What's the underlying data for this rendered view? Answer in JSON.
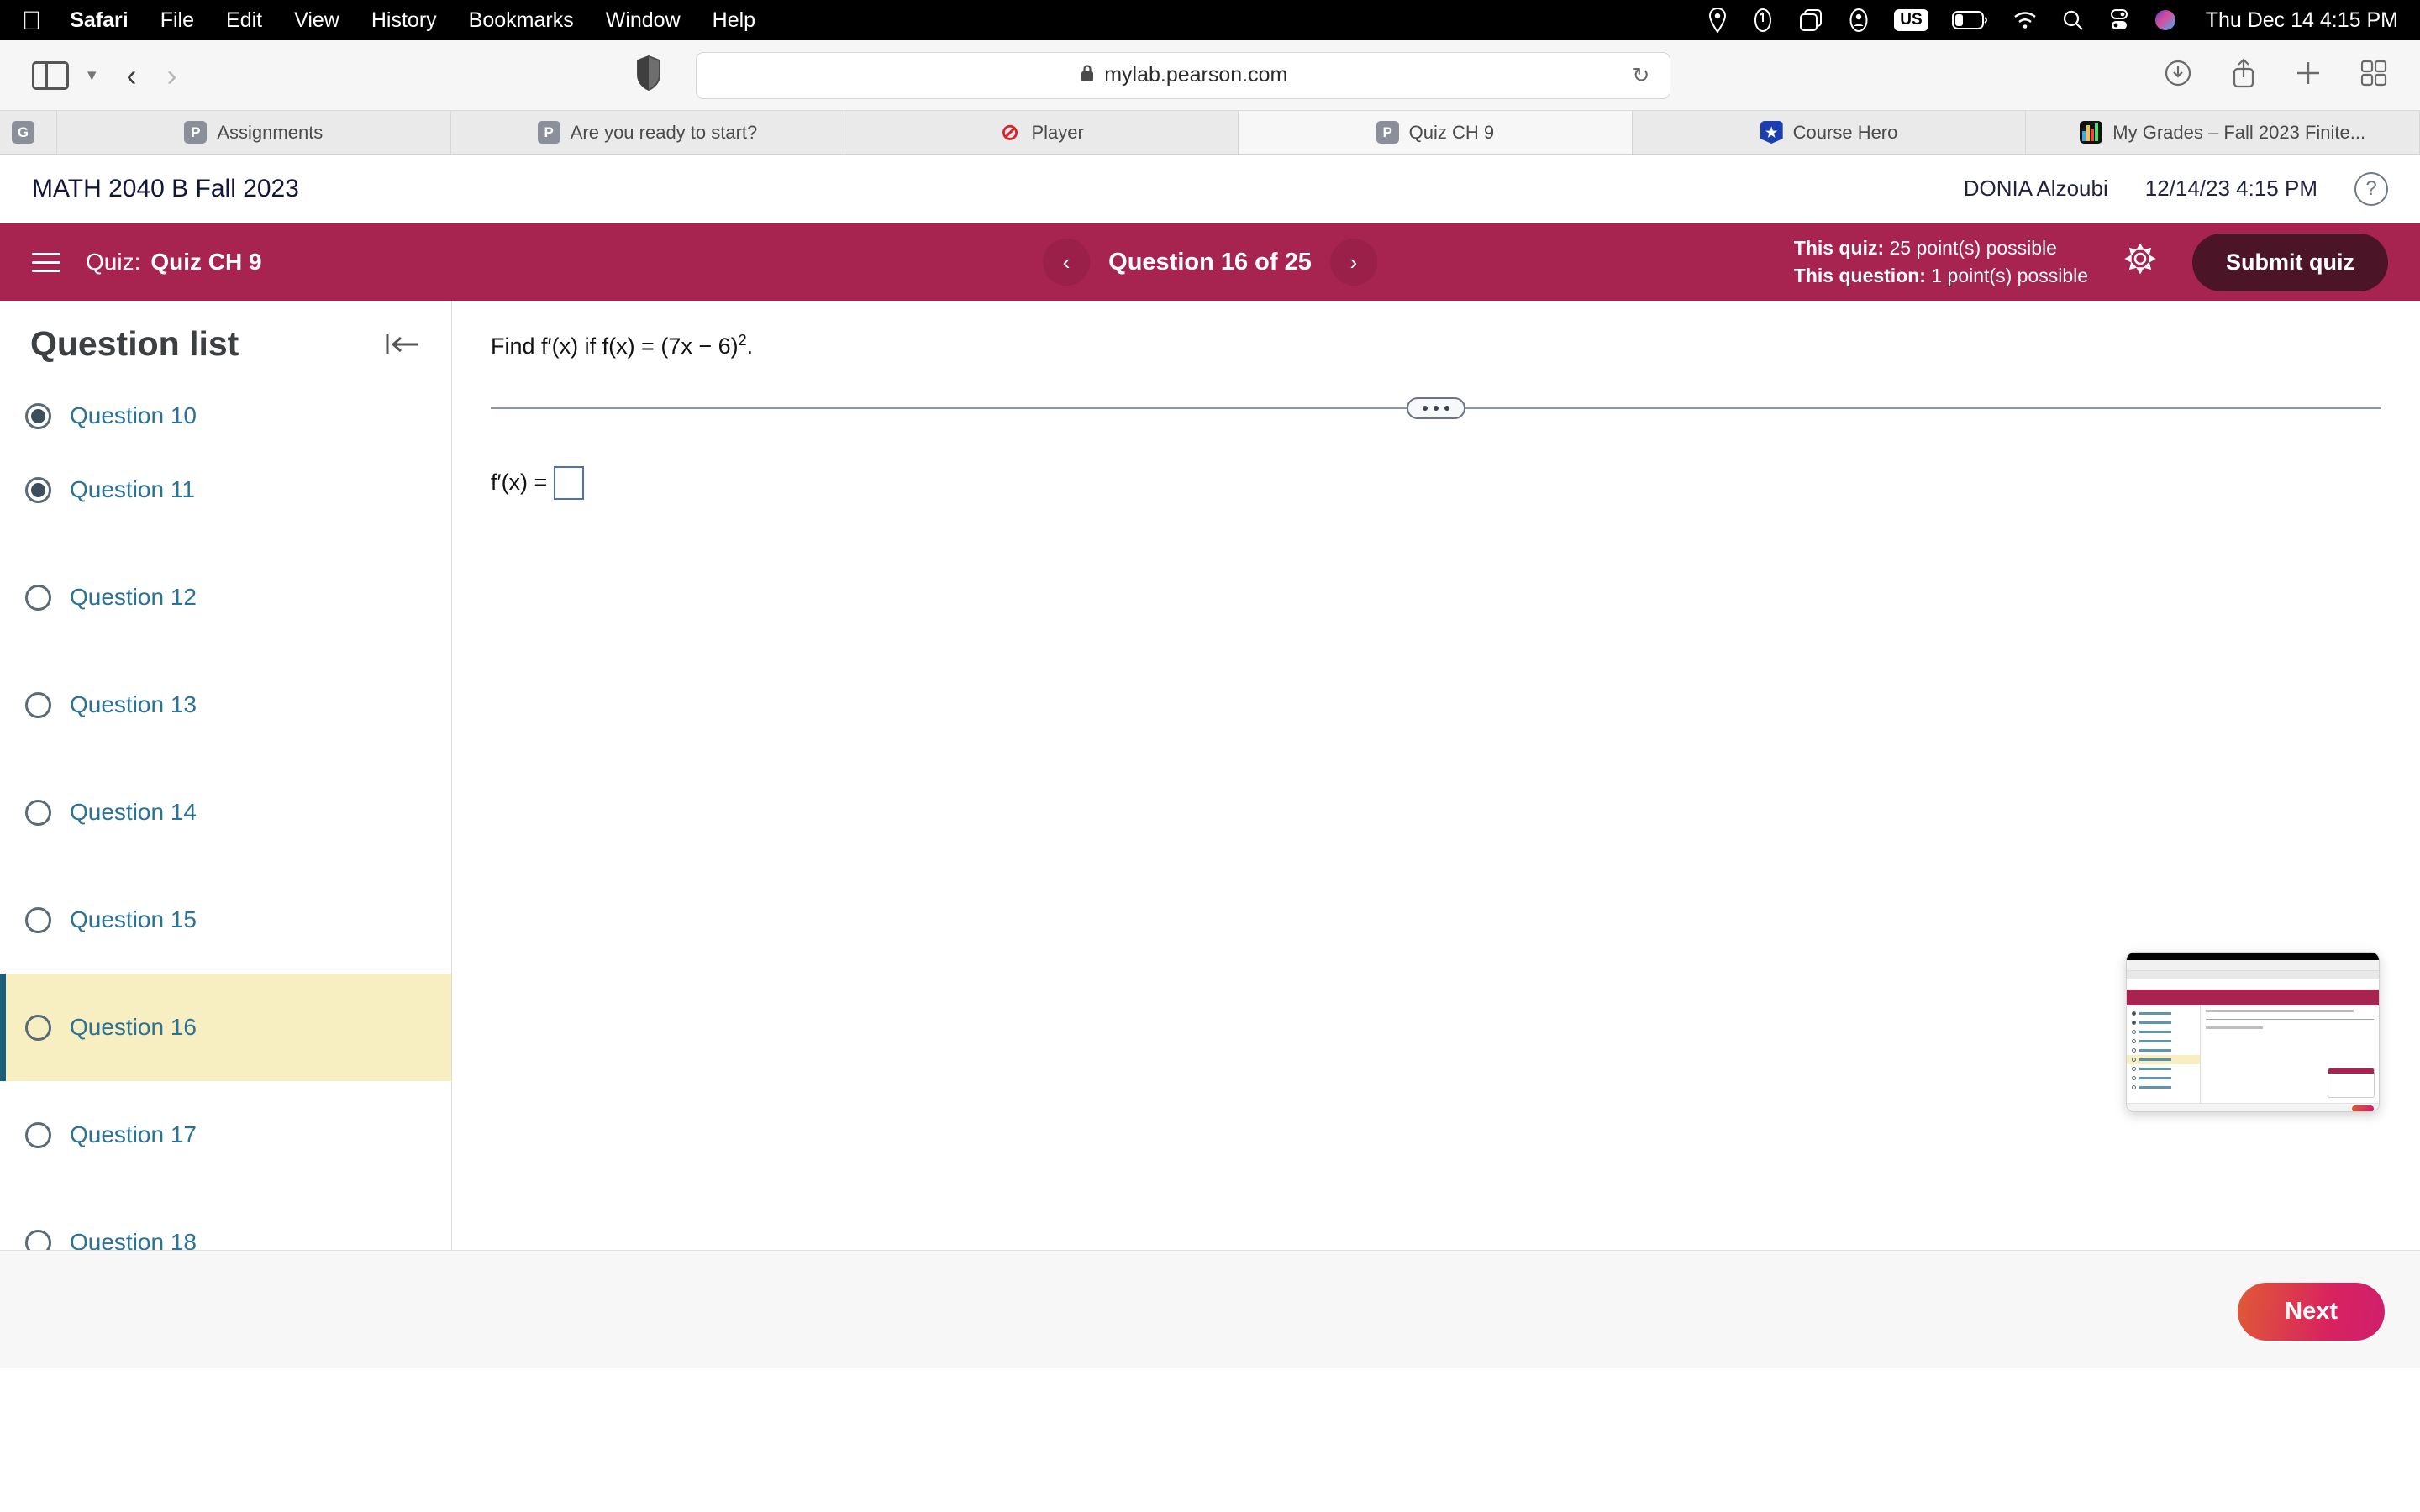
{
  "menubar": {
    "apple_icon": "apple-logo",
    "items": [
      {
        "label": "Safari",
        "bold": true
      },
      {
        "label": "File",
        "bold": false
      },
      {
        "label": "Edit",
        "bold": false
      },
      {
        "label": "View",
        "bold": false
      },
      {
        "label": "History",
        "bold": false
      },
      {
        "label": "Bookmarks",
        "bold": false
      },
      {
        "label": "Window",
        "bold": false
      },
      {
        "label": "Help",
        "bold": false
      }
    ],
    "status_icons": [
      "location-pin-icon",
      "clock-icon",
      "screen-mirroring-icon",
      "user-account-icon",
      "input-source-us-icon",
      "battery-icon",
      "wifi-icon",
      "spotlight-search-icon",
      "control-center-icon",
      "siri-icon"
    ],
    "input_source": "US",
    "clock": "Thu Dec 14  4:15 PM"
  },
  "toolbar": {
    "sidebar_icon": "sidebar-toggle-icon",
    "chevron_icon": "chevron-down-icon",
    "back_icon": "back-arrow-icon",
    "forward_icon": "forward-arrow-icon",
    "shield_icon": "privacy-shield-icon",
    "lock_icon": "lock-icon",
    "url": "mylab.pearson.com",
    "placeholder": "Search or enter website name",
    "reload_icon": "reload-icon",
    "downloads_icon": "downloads-icon",
    "share_icon": "share-icon",
    "newtab_icon": "new-tab-icon",
    "taboverview_icon": "tab-overview-icon"
  },
  "tabs": [
    {
      "label": "",
      "favicon": "g-favicon",
      "active": false
    },
    {
      "label": "Assignments",
      "favicon": "pearson-favicon",
      "active": false
    },
    {
      "label": "Are you ready to start?",
      "favicon": "pearson-favicon",
      "active": false
    },
    {
      "label": "Player",
      "favicon": "player-favicon",
      "active": false
    },
    {
      "label": "Quiz CH 9",
      "favicon": "pearson-favicon",
      "active": true
    },
    {
      "label": "Course Hero",
      "favicon": "coursehero-favicon",
      "active": false
    },
    {
      "label": "My Grades – Fall 2023 Finite...",
      "favicon": "grades-favicon",
      "active": false
    }
  ],
  "course_header": {
    "title": "MATH 2040 B Fall 2023",
    "user": "DONIA Alzoubi",
    "timestamp": "12/14/23 4:15 PM",
    "help_icon": "help-question-icon"
  },
  "quizbar": {
    "menu_icon": "hamburger-menu-icon",
    "quiz_label": "Quiz:",
    "quiz_name": "Quiz CH 9",
    "prev_icon": "chevron-left-icon",
    "next_icon": "chevron-right-icon",
    "question_counter": "Question 16 of 25",
    "quiz_points_label": "This quiz:",
    "quiz_points_value": "25 point(s) possible",
    "question_points_label": "This question:",
    "question_points_value": "1 point(s) possible",
    "settings_icon": "gear-icon",
    "submit_label": "Submit quiz",
    "accent_color": "#a72450",
    "submit_color": "#4b1427"
  },
  "question_list": {
    "title": "Question list",
    "collapse_icon": "collapse-panel-icon",
    "items": [
      {
        "label": "Question 10",
        "answered": true,
        "current": false
      },
      {
        "label": "Question 11",
        "answered": true,
        "current": false
      },
      {
        "label": "Question 12",
        "answered": false,
        "current": false
      },
      {
        "label": "Question 13",
        "answered": false,
        "current": false
      },
      {
        "label": "Question 14",
        "answered": false,
        "current": false
      },
      {
        "label": "Question 15",
        "answered": false,
        "current": false
      },
      {
        "label": "Question 16",
        "answered": false,
        "current": true
      },
      {
        "label": "Question 17",
        "answered": false,
        "current": false
      },
      {
        "label": "Question 18",
        "answered": false,
        "current": false
      }
    ],
    "highlight_color": "#f7eec2",
    "link_color": "#2a7296"
  },
  "main": {
    "question_prefix": "Find f′(x) if f(x) = (7x − 6)",
    "question_exponent": "2",
    "question_suffix": ".",
    "divider_handle_icon": "resize-handle-icon",
    "answer_label": "f′(x) =",
    "answer_value": ""
  },
  "footer": {
    "next_label": "Next"
  },
  "thumbnail": {
    "name": "screen-recording-preview"
  }
}
